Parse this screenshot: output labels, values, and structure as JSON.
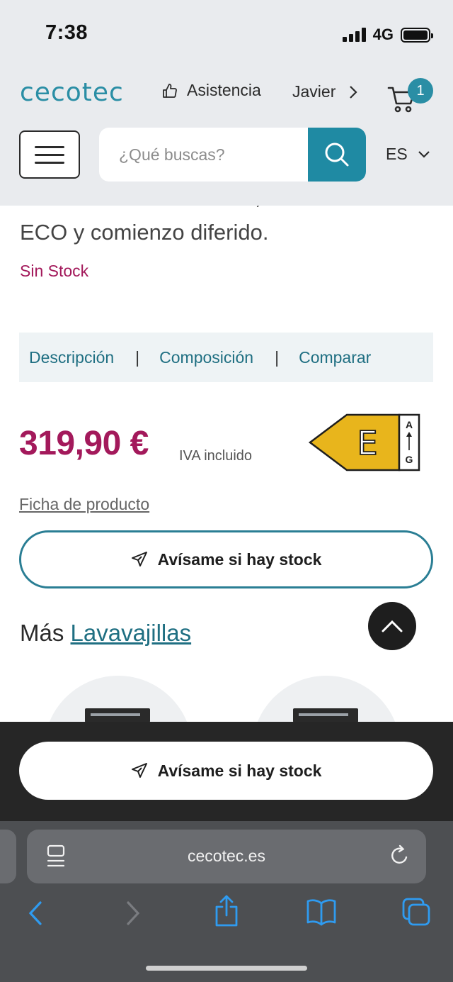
{
  "status": {
    "time": "7:38",
    "network": "4G"
  },
  "header": {
    "logo": "cecotec",
    "assistance": "Asistencia",
    "user": "Javier",
    "cart_count": "1",
    "search_placeholder": "¿Qué buscas?",
    "language": "ES"
  },
  "product": {
    "description_cut": "filtro ADT Antibacteriano, modo",
    "description": "ECO y comienzo diferido.",
    "stock": "Sin Stock",
    "tabs": [
      "Descripción",
      "Composición",
      "Comparar"
    ],
    "tab_separator": "|",
    "price": "319,90 €",
    "vat": "IVA incluido",
    "energy": {
      "class": "E",
      "scale_top": "A",
      "scale_bottom": "G",
      "color": "#e8b51c"
    },
    "datasheet": "Ficha de producto",
    "notify": "Avísame si hay stock"
  },
  "more": {
    "prefix": "Más",
    "category": "Lavavajillas"
  },
  "sticky": {
    "notify": "Avísame si hay stock"
  },
  "browser": {
    "url": "cecotec.es"
  },
  "colors": {
    "brand": "#2a8ea5",
    "price": "#a3195b",
    "stock": "#a3195b"
  }
}
